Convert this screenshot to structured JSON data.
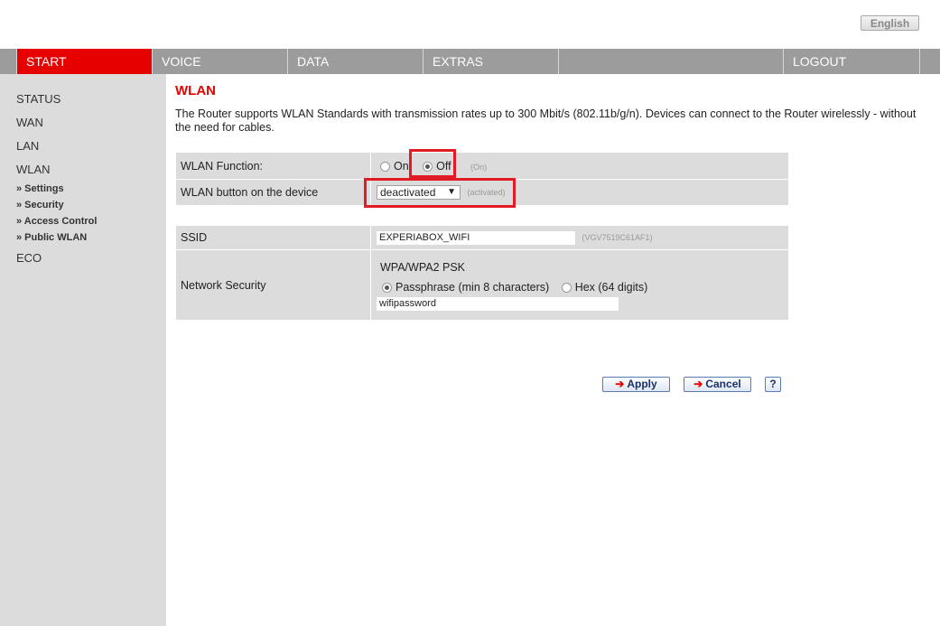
{
  "header": {
    "language_button": "English"
  },
  "nav": {
    "items": [
      {
        "label": "START"
      },
      {
        "label": "VOICE"
      },
      {
        "label": "DATA"
      },
      {
        "label": "EXTRAS"
      },
      {
        "label": ""
      },
      {
        "label": "LOGOUT"
      }
    ]
  },
  "sidebar": {
    "items": [
      "STATUS",
      "WAN",
      "LAN",
      "WLAN"
    ],
    "subitems": [
      "» Settings",
      "» Security",
      "» Access Control",
      "» Public WLAN"
    ],
    "last_item": "ECO"
  },
  "main": {
    "title": "WLAN",
    "intro": "The Router supports WLAN Standards with transmission rates up to 300 Mbit/s (802.11b/g/n). Devices can connect to the Router wirelessly - without the need for cables.",
    "wlan_function": {
      "label": "WLAN Function:",
      "on_label": "On",
      "off_label": "Off",
      "selected": "Off",
      "default_hint": "(On)"
    },
    "wlan_button": {
      "label": "WLAN button on the device",
      "value": "deactivated",
      "default_hint": "(activated)"
    },
    "ssid": {
      "label": "SSID",
      "value": "EXPERIABOX_WIFI",
      "default_hint": "(VGV7519C61AF1)"
    },
    "network_security": {
      "label": "Network Security",
      "mode": "WPA/WPA2 PSK",
      "passphrase_label": "Passphrase (min 8 characters)",
      "hex_label": "Hex (64 digits)",
      "selected": "Passphrase",
      "key_value": "wifipassword"
    }
  },
  "actions": {
    "apply": "Apply",
    "cancel": "Cancel",
    "help": "?"
  },
  "colors": {
    "accent": "#e60000",
    "highlight": "#e01b24",
    "nav_bg": "#9c9c9c",
    "panel_bg": "#dcdcdc"
  }
}
